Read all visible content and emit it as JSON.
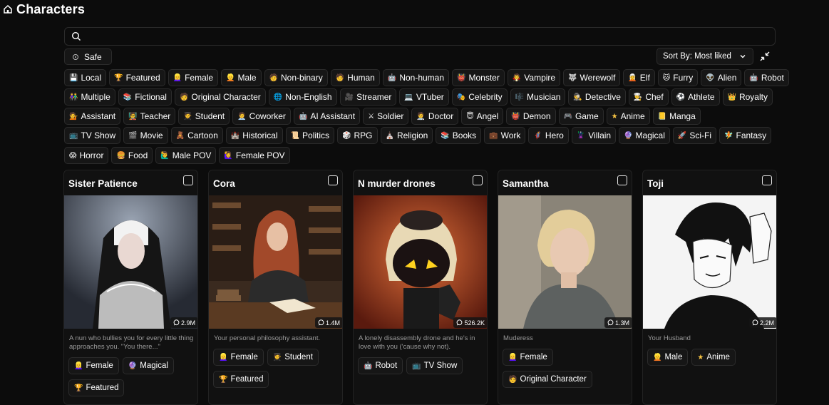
{
  "header": {
    "title": "Characters"
  },
  "search": {
    "value": "",
    "placeholder": ""
  },
  "controls": {
    "safe_label": "Safe",
    "sort_label": "Sort By: Most liked"
  },
  "tags": [
    [
      {
        "icon": "💾",
        "label": "Local"
      },
      {
        "icon": "🏆",
        "label": "Featured"
      },
      {
        "icon": "👱‍♀️",
        "label": "Female"
      },
      {
        "icon": "👱",
        "label": "Male"
      },
      {
        "icon": "🧑",
        "label": "Non-binary"
      },
      {
        "icon": "🧑",
        "label": "Human"
      },
      {
        "icon": "🤖",
        "label": "Non-human"
      },
      {
        "icon": "👹",
        "label": "Monster"
      },
      {
        "icon": "🧛",
        "label": "Vampire"
      },
      {
        "icon": "🐺",
        "label": "Werewolf"
      },
      {
        "icon": "🧝",
        "label": "Elf"
      },
      {
        "icon": "🐱",
        "label": "Furry"
      },
      {
        "icon": "👽",
        "label": "Alien"
      },
      {
        "icon": "🤖",
        "label": "Robot"
      }
    ],
    [
      {
        "icon": "👫",
        "label": "Multiple"
      },
      {
        "icon": "📚",
        "label": "Fictional"
      },
      {
        "icon": "🧑",
        "label": "Original Character"
      },
      {
        "icon": "🌐",
        "label": "Non-English"
      },
      {
        "icon": "🎥",
        "label": "Streamer"
      },
      {
        "icon": "💻",
        "label": "VTuber"
      },
      {
        "icon": "🎭",
        "label": "Celebrity"
      },
      {
        "icon": "🎼",
        "label": "Musician"
      },
      {
        "icon": "🕵",
        "label": "Detective"
      },
      {
        "icon": "👨‍🍳",
        "label": "Chef"
      },
      {
        "icon": "⚽",
        "label": "Athlete"
      },
      {
        "icon": "👑",
        "label": "Royalty"
      }
    ],
    [
      {
        "icon": "💁",
        "label": "Assistant"
      },
      {
        "icon": "🧑‍🏫",
        "label": "Teacher"
      },
      {
        "icon": "🧑‍🎓",
        "label": "Student"
      },
      {
        "icon": "🧑‍💼",
        "label": "Coworker"
      },
      {
        "icon": "🤖",
        "label": "AI Assistant"
      },
      {
        "icon": "⚔",
        "label": "Soldier"
      },
      {
        "icon": "🧑‍⚕️",
        "label": "Doctor"
      },
      {
        "icon": "😇",
        "label": "Angel"
      },
      {
        "icon": "👹",
        "label": "Demon"
      },
      {
        "icon": "🎮",
        "label": "Game"
      },
      {
        "icon": "★",
        "label": "Anime"
      },
      {
        "icon": "📒",
        "label": "Manga"
      }
    ],
    [
      {
        "icon": "📺",
        "label": "TV Show"
      },
      {
        "icon": "🎬",
        "label": "Movie"
      },
      {
        "icon": "🧸",
        "label": "Cartoon"
      },
      {
        "icon": "🏰",
        "label": "Historical"
      },
      {
        "icon": "📜",
        "label": "Politics"
      },
      {
        "icon": "🎲",
        "label": "RPG"
      },
      {
        "icon": "⛪",
        "label": "Religion"
      },
      {
        "icon": "📚",
        "label": "Books"
      },
      {
        "icon": "💼",
        "label": "Work"
      },
      {
        "icon": "🦸",
        "label": "Hero"
      },
      {
        "icon": "🦹",
        "label": "Villain"
      },
      {
        "icon": "🔮",
        "label": "Magical"
      },
      {
        "icon": "🚀",
        "label": "Sci-Fi"
      },
      {
        "icon": "🧚",
        "label": "Fantasy"
      }
    ],
    [
      {
        "icon": "😱",
        "label": "Horror"
      },
      {
        "icon": "🍔",
        "label": "Food"
      },
      {
        "icon": "🙋‍♂️",
        "label": "Male POV"
      },
      {
        "icon": "🙋‍♀️",
        "label": "Female POV"
      }
    ]
  ],
  "cards": [
    {
      "name": "Sister Patience",
      "count": "2.9M",
      "description": "A nun who bullies you for every little thing approaches you. \"You there...\"",
      "tags": [
        {
          "icon": "👱‍♀️",
          "label": "Female"
        },
        {
          "icon": "🔮",
          "label": "Magical"
        },
        {
          "icon": "🏆",
          "label": "Featured"
        }
      ]
    },
    {
      "name": "Cora",
      "count": "1.4M",
      "description": "Your personal philosophy assistant.",
      "tags": [
        {
          "icon": "👱‍♀️",
          "label": "Female"
        },
        {
          "icon": "🧑‍🎓",
          "label": "Student"
        },
        {
          "icon": "🏆",
          "label": "Featured"
        }
      ]
    },
    {
      "name": "N murder drones",
      "count": "526.2K",
      "description": "A lonely disassembly drone and he's in love with you ('cause why not).",
      "tags": [
        {
          "icon": "🤖",
          "label": "Robot"
        },
        {
          "icon": "📺",
          "label": "TV Show"
        }
      ]
    },
    {
      "name": "Samantha",
      "count": "1.3M",
      "description": "Muderess",
      "tags": [
        {
          "icon": "👱‍♀️",
          "label": "Female"
        },
        {
          "icon": "🧑",
          "label": "Original Character"
        }
      ]
    },
    {
      "name": "Toji",
      "count": "2.2M",
      "description": "Your Husband",
      "tags": [
        {
          "icon": "👱",
          "label": "Male"
        },
        {
          "icon": "★",
          "label": "Anime"
        }
      ]
    }
  ]
}
